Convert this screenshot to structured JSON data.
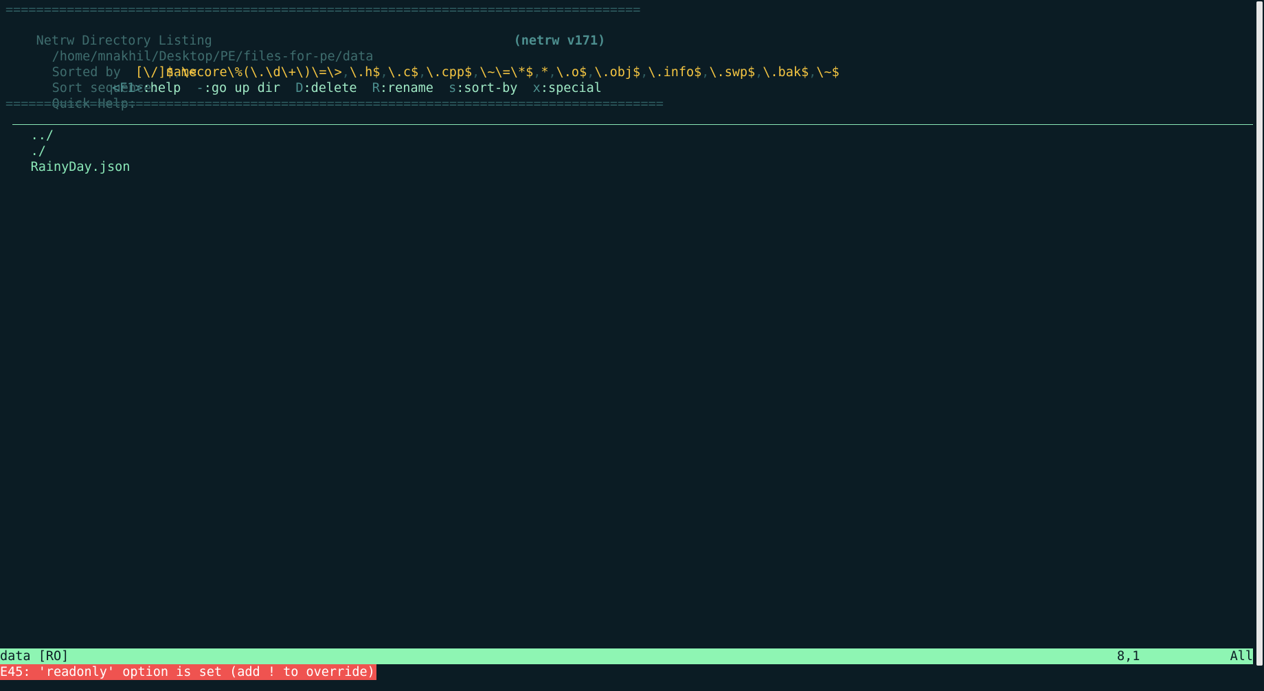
{
  "netrw": {
    "rule": "===================================================================================",
    "title": "Netrw Directory Listing",
    "version": "(netrw v171)",
    "path": "/home/mnakhil/Desktop/PE/files-for-pe/data",
    "sorted_by_label": "Sorted by",
    "sorted_by_value": "name",
    "sort_seq_label": "Sort sequence:",
    "sort_seq_items": [
      "[\\/]$",
      "\\<core\\%(\\.\\d\\+\\)\\=\\>",
      "\\.h$",
      "\\.c$",
      "\\.cpp$",
      "\\~\\=\\*$",
      "*",
      "\\.o$",
      "\\.obj$",
      "\\.info$",
      "\\.swp$",
      "\\.bak$",
      "\\~$"
    ],
    "quick_help_label": "Quick Help:",
    "help": [
      {
        "key": "<F1>",
        "text": ":help"
      },
      {
        "key": "-",
        "text": ":go up dir"
      },
      {
        "key": "D",
        "text": ":delete"
      },
      {
        "key": "R",
        "text": ":rename"
      },
      {
        "key": "s",
        "text": ":sort-by"
      },
      {
        "key": "x",
        "text": ":special"
      }
    ],
    "rule2": "======================================================================================"
  },
  "listing": {
    "entries": [
      "../",
      "./",
      "RainyDay.json"
    ]
  },
  "status": {
    "buffer": "data [RO]",
    "position": "8,1",
    "percent": "All"
  },
  "message": {
    "error": "E45: 'readonly' option is set (add ! to override)"
  },
  "colors": {
    "background": "#0b1c24",
    "status_bg": "#8ef5b3",
    "error_bg": "#ef5350",
    "accent_yellow": "#f4c542",
    "accent_green": "#8be9b8"
  }
}
